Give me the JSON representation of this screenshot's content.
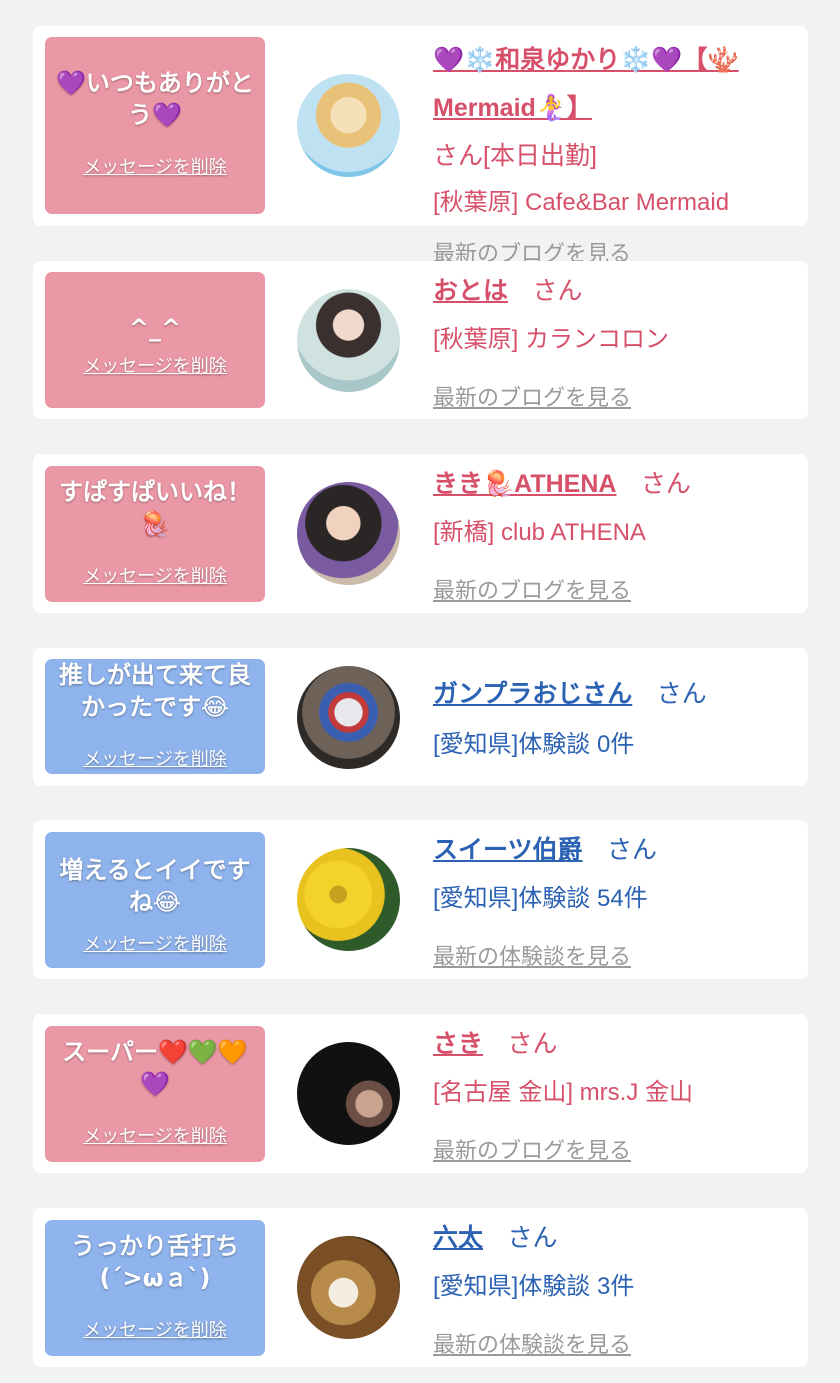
{
  "delete_label": "メッセージを削除",
  "cards": [
    {
      "message": "💜いつもありがとう💜",
      "name": "💜❄️和泉ゆかり❄️💜【🪸Mermaid🧜‍♀️】",
      "suffix": "さん[本日出勤]",
      "shop": "[秋葉原] Cafe&Bar Mermaid",
      "more": "最新のブログを見る"
    },
    {
      "message": "^_^",
      "name": "おとは",
      "suffix": "さん",
      "shop": "[秋葉原] カランコロン",
      "more": "最新のブログを見る"
    },
    {
      "message": "すぱすぱいいね！🪼",
      "name": "きき🪼ATHENA",
      "suffix": "さん",
      "shop": "[新橋] club ATHENA",
      "more": "最新のブログを見る"
    },
    {
      "message": "推しが出て来て良かったです😂",
      "name": "ガンプラおじさん",
      "suffix": "さん",
      "shop": "[愛知県]体験談 0件",
      "more": ""
    },
    {
      "message": "増えるとイイですね😂",
      "name": "スイーツ伯爵",
      "suffix": "さん",
      "shop": "[愛知県]体験談 54件",
      "more": "最新の体験談を見る"
    },
    {
      "message": "スーパー❤️💚🧡💜",
      "name": "さき",
      "suffix": "さん",
      "shop": "[名古屋 金山] mrs.J 金山",
      "more": "最新のブログを見る"
    },
    {
      "message": "うっかり舌打ち(´>ωａ`)",
      "name": "六太",
      "suffix": "さん",
      "shop": "[愛知県]体験談 3件",
      "more": "最新の体験談を見る"
    }
  ],
  "colors": {
    "pink_bubble": "#eb98a6",
    "blue_bubble": "#8fb3ec",
    "pink_text": "#d7506a",
    "blue_text": "#2b62b3"
  }
}
